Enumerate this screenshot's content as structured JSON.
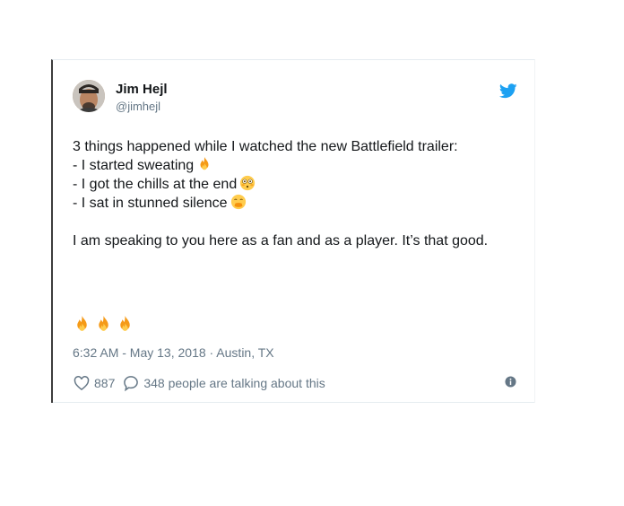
{
  "author": {
    "name": "Jim Hejl",
    "handle": "@jimhejl"
  },
  "tweet": {
    "lines": [
      "3 things happened while I watched the new Battlefield trailer:",
      "- I started sweating",
      "- I got the chills at the end",
      "- I sat in stunned silence"
    ],
    "paragraph": "I am speaking to you here as a fan and as a player. It’s that good.",
    "emoji_names": [
      "fire-emoji",
      "flushed-face-emoji",
      "hand-over-mouth-emoji",
      "fire-emoji",
      "fire-emoji",
      "fire-emoji"
    ],
    "timestamp": "6:32 AM - May 13, 2018 · Austin, TX"
  },
  "actions": {
    "likes": "887",
    "conversation": "348 people are talking about this"
  },
  "icons": {
    "brand": "twitter-bird-icon",
    "like": "heart-icon",
    "reply": "speech-bubble-icon",
    "info": "info-icon"
  },
  "colors": {
    "brand": "#1da1f2",
    "text": "#14171a",
    "muted": "#657786",
    "fire": "#f59a17"
  }
}
